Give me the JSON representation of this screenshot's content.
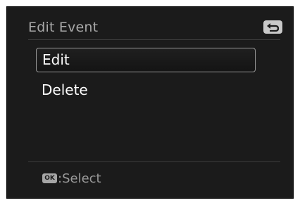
{
  "header": {
    "title": "Edit Event",
    "back_icon": "back-return-icon"
  },
  "menu": {
    "items": [
      {
        "label": "Edit",
        "selected": true
      },
      {
        "label": "Delete",
        "selected": false
      }
    ]
  },
  "footer": {
    "ok_badge": "OK",
    "hint": ":Select"
  },
  "colors": {
    "background": "#1b1b1b",
    "title_text": "#a8a8a8",
    "item_text": "#ffffff",
    "selection_border": "#9a9a9a"
  }
}
